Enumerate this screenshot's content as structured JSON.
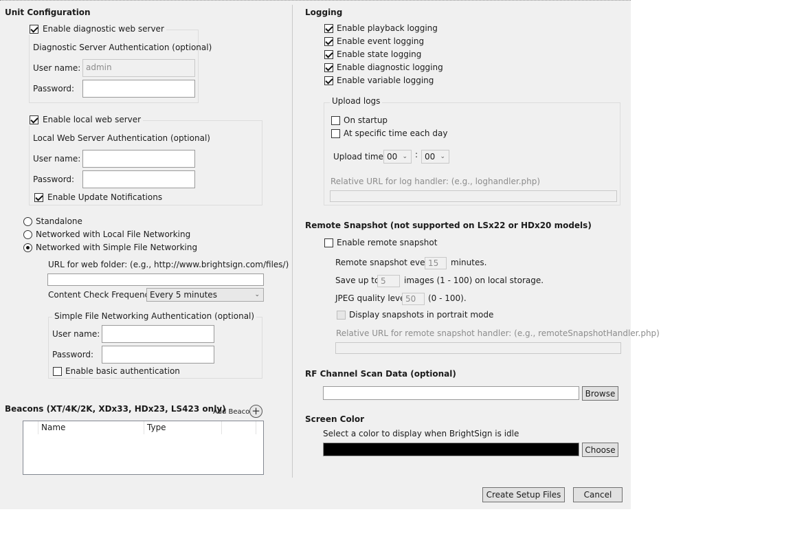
{
  "unit_config": {
    "title": "Unit Configuration",
    "diag": {
      "checkbox_label": "Enable diagnostic web server",
      "auth_title": "Diagnostic Server Authentication (optional)",
      "username_label": "User name:",
      "username_value": "admin",
      "password_label": "Password:"
    },
    "local": {
      "checkbox_label": "Enable local web server",
      "auth_title": "Local Web Server Authentication (optional)",
      "username_label": "User name:",
      "password_label": "Password:",
      "update_notifications_label": "Enable Update Notifications"
    },
    "networking": {
      "standalone_label": "Standalone",
      "local_file_label": "Networked with Local File Networking",
      "simple_file_label": "Networked with Simple File Networking",
      "url_label": "URL for web folder: (e.g., http://www.brightsign.com/files/)",
      "check_freq_label": "Content Check Frequency:",
      "check_freq_value": "Every 5 minutes",
      "auth_title": "Simple File Networking Authentication (optional)",
      "username_label": "User name:",
      "password_label": "Password:",
      "basic_auth_label": "Enable basic authentication"
    },
    "beacons": {
      "title": "Beacons (XT/4K/2K, XDx33, HDx23, LS423 only)",
      "add_label": "Add Beacon",
      "columns": [
        "Name",
        "Type"
      ]
    }
  },
  "logging": {
    "title": "Logging",
    "options": [
      "Enable playback logging",
      "Enable event logging",
      "Enable state logging",
      "Enable diagnostic logging",
      "Enable variable logging"
    ],
    "upload": {
      "title": "Upload logs",
      "on_startup_label": "On startup",
      "specific_time_label": "At specific time each day",
      "upload_time_label": "Upload time:",
      "hour": "00",
      "separator": ":",
      "minute": "00",
      "url_label": "Relative URL for log handler: (e.g., loghandler.php)"
    }
  },
  "snapshot": {
    "title": "Remote Snapshot (not supported on LSx22 or HDx20 models)",
    "enable_label": "Enable remote snapshot",
    "every_label": "Remote snapshot every",
    "every_value": "15",
    "every_unit": "minutes.",
    "save_label": "Save up to",
    "save_value": "5",
    "save_unit": "images (1 - 100) on local storage.",
    "jpeg_label": "JPEG quality level",
    "jpeg_value": "50",
    "jpeg_unit": "(0 - 100).",
    "portrait_label": "Display snapshots in portrait mode",
    "url_label": "Relative URL for remote snapshot handler: (e.g., remoteSnapshotHandler.php)"
  },
  "rf_scan": {
    "title": "RF Channel Scan Data (optional)",
    "browse_label": "Browse"
  },
  "screen_color": {
    "title": "Screen Color",
    "description": "Select a color to display when BrightSign is idle",
    "color": "#000000",
    "choose_label": "Choose"
  },
  "footer": {
    "create_label": "Create Setup Files",
    "cancel_label": "Cancel"
  }
}
